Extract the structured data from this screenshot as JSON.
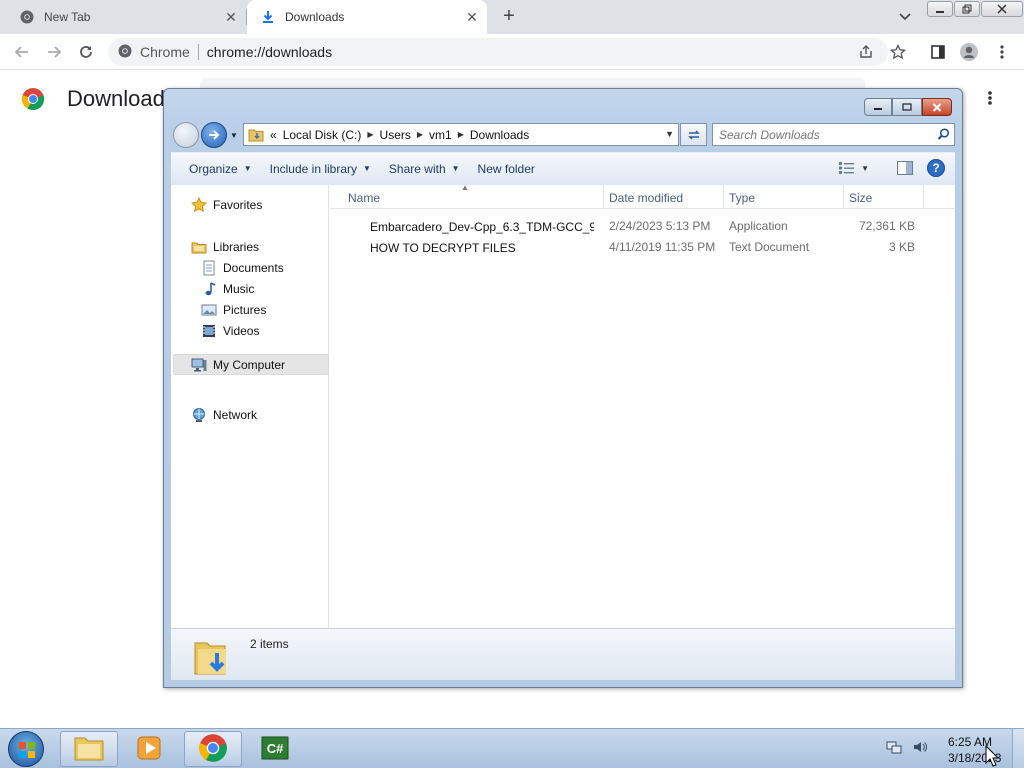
{
  "browser": {
    "tabs": [
      {
        "label": "New Tab",
        "icon": "chrome-icon"
      },
      {
        "label": "Downloads",
        "icon": "download-icon",
        "active": true
      }
    ],
    "omnibox": {
      "site_label": "Chrome",
      "url": "chrome://downloads"
    },
    "page": {
      "title": "Download"
    }
  },
  "explorer": {
    "address": {
      "overflow": "«",
      "crumbs": [
        "Local Disk (C:)",
        "Users",
        "vm1",
        "Downloads"
      ]
    },
    "search": {
      "placeholder": "Search Downloads"
    },
    "commands": {
      "organize": "Organize",
      "include_library": "Include in library",
      "share_with": "Share with",
      "new_folder": "New folder"
    },
    "nav": {
      "favorites": "Favorites",
      "libraries": "Libraries",
      "documents": "Documents",
      "music": "Music",
      "pictures": "Pictures",
      "videos": "Videos",
      "my_computer": "My Computer",
      "network": "Network"
    },
    "columns": {
      "name": "Name",
      "date": "Date modified",
      "type": "Type",
      "size": "Size"
    },
    "files": [
      {
        "name": "Embarcadero_Dev-Cpp_6.3_TDM-GCC_9....",
        "date": "2/24/2023 5:13 PM",
        "type": "Application",
        "size": "72,361 KB",
        "icon": "devcpp-app-icon"
      },
      {
        "name": "HOW TO DECRYPT FILES",
        "date": "4/11/2019 11:35 PM",
        "type": "Text Document",
        "size": "3 KB",
        "icon": "text-document-icon"
      }
    ],
    "details": {
      "item_count": "2 items"
    }
  },
  "taskbar": {
    "clock": {
      "time": "6:25 AM",
      "date": "3/18/2023"
    }
  },
  "colors": {
    "chrome_tabstrip": "#dee1e6",
    "explorer_frame": "#b9cfe8",
    "taskbar": "#b8cde6",
    "close_button": "#c7452a"
  }
}
